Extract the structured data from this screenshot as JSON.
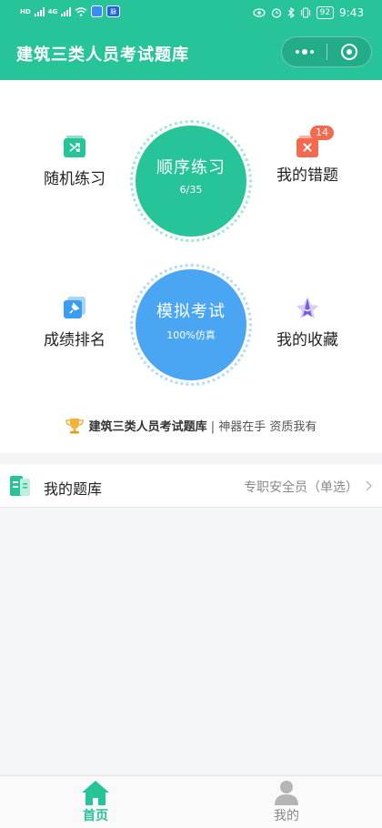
{
  "status_bar": {
    "time": "9:43",
    "battery": "92",
    "hd_label": "HD",
    "net_label": "4G",
    "mini_app_label": "脉"
  },
  "header": {
    "title": "建筑三类人员考试题库"
  },
  "features": {
    "sequential": {
      "label": "顺序练习",
      "progress": "6/35"
    },
    "random": {
      "label": "随机练习"
    },
    "wrong": {
      "label": "我的错题",
      "badge": "14"
    },
    "mock_exam": {
      "label": "模拟考试",
      "sub": "100%仿真"
    },
    "ranking": {
      "label": "成绩排名"
    },
    "favorites": {
      "label": "我的收藏"
    }
  },
  "slogan": {
    "title": "建筑三类人员考试题库",
    "subtitle": " | 神器在手 资质我有"
  },
  "bank_row": {
    "title": "我的题库",
    "value": "专职安全员（单选）"
  },
  "bottom_nav": {
    "home": "首页",
    "mine": "我的"
  },
  "colors": {
    "primary": "#27c49a",
    "blue": "#4aa6f3",
    "badge": "#f26b4f"
  }
}
